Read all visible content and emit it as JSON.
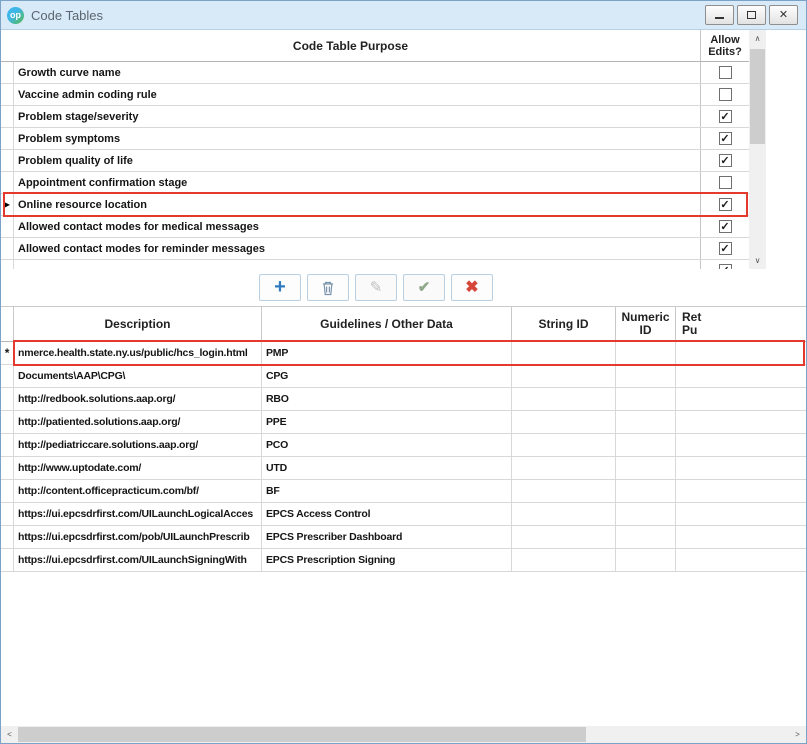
{
  "window": {
    "title": "Code Tables",
    "logo_text": "op"
  },
  "top_table": {
    "purpose_header": "Code Table Purpose",
    "allow_edits_header": "Allow\nEdits?",
    "selected_marker": "▶",
    "rows": [
      {
        "label": "Growth curve name",
        "checked": false,
        "selected": false,
        "highlighted": false
      },
      {
        "label": "Vaccine admin coding rule",
        "checked": false,
        "selected": false,
        "highlighted": false
      },
      {
        "label": "Problem stage/severity",
        "checked": true,
        "selected": false,
        "highlighted": false
      },
      {
        "label": "Problem symptoms",
        "checked": true,
        "selected": false,
        "highlighted": false
      },
      {
        "label": "Problem quality of life",
        "checked": true,
        "selected": false,
        "highlighted": false
      },
      {
        "label": "Appointment confirmation stage",
        "checked": false,
        "selected": false,
        "highlighted": false
      },
      {
        "label": "Online resource location",
        "checked": true,
        "selected": true,
        "highlighted": true
      },
      {
        "label": "Allowed contact modes for medical messages",
        "checked": true,
        "selected": false,
        "highlighted": false
      },
      {
        "label": "Allowed contact modes for reminder messages",
        "checked": true,
        "selected": false,
        "highlighted": false
      },
      {
        "label": "",
        "checked": true,
        "selected": false,
        "highlighted": false
      }
    ]
  },
  "toolbar": {
    "buttons": [
      {
        "name": "add",
        "icon": "plus-icon",
        "enabled": true
      },
      {
        "name": "delete",
        "icon": "trash-icon",
        "enabled": true
      },
      {
        "name": "edit",
        "icon": "pencil-icon",
        "enabled": false
      },
      {
        "name": "accept",
        "icon": "check-icon",
        "enabled": false
      },
      {
        "name": "cancel",
        "icon": "x-icon",
        "enabled": true
      }
    ]
  },
  "bottom_table": {
    "headers": [
      "Description",
      "Guidelines / Other Data",
      "String ID",
      "Numeric\nID",
      "Ret\nPu"
    ],
    "rows": [
      {
        "marker": "*",
        "description": "nmerce.health.state.ny.us/public/hcs_login.html",
        "guidelines": "PMP",
        "string_id": "",
        "numeric_id": "",
        "retired": "",
        "highlighted": true
      },
      {
        "marker": "",
        "description": "Documents\\AAP\\CPG\\",
        "guidelines": "CPG",
        "string_id": "",
        "numeric_id": "",
        "retired": "",
        "highlighted": false
      },
      {
        "marker": "",
        "description": "http://redbook.solutions.aap.org/",
        "guidelines": "RBO",
        "string_id": "",
        "numeric_id": "",
        "retired": "",
        "highlighted": false
      },
      {
        "marker": "",
        "description": "http://patiented.solutions.aap.org/",
        "guidelines": "PPE",
        "string_id": "",
        "numeric_id": "",
        "retired": "",
        "highlighted": false
      },
      {
        "marker": "",
        "description": "http://pediatriccare.solutions.aap.org/",
        "guidelines": "PCO",
        "string_id": "",
        "numeric_id": "",
        "retired": "",
        "highlighted": false
      },
      {
        "marker": "",
        "description": "http://www.uptodate.com/",
        "guidelines": "UTD",
        "string_id": "",
        "numeric_id": "",
        "retired": "",
        "highlighted": false
      },
      {
        "marker": "",
        "description": "http://content.officepracticum.com/bf/",
        "guidelines": "BF",
        "string_id": "",
        "numeric_id": "",
        "retired": "",
        "highlighted": false
      },
      {
        "marker": "",
        "description": "https://ui.epcsdrfirst.com/UILaunchLogicalAcces",
        "guidelines": "EPCS Access Control",
        "string_id": "",
        "numeric_id": "",
        "retired": "",
        "highlighted": false
      },
      {
        "marker": "",
        "description": "https://ui.epcsdrfirst.com/pob/UILaunchPrescrib",
        "guidelines": "EPCS Prescriber Dashboard",
        "string_id": "",
        "numeric_id": "",
        "retired": "",
        "highlighted": false
      },
      {
        "marker": "",
        "description": "https://ui.epcsdrfirst.com/UILaunchSigningWith",
        "guidelines": "EPCS Prescription Signing",
        "string_id": "",
        "numeric_id": "",
        "retired": "",
        "highlighted": false
      }
    ]
  },
  "scrollbars": {
    "up_glyph": "∧",
    "down_glyph": "∨",
    "left_glyph": "<",
    "right_glyph": ">"
  }
}
